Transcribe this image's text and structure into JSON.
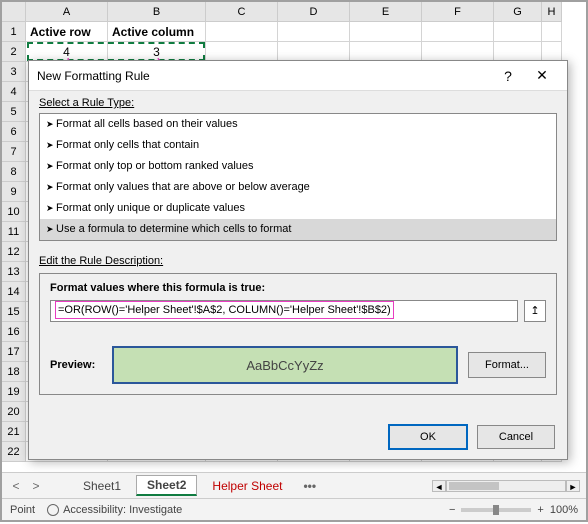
{
  "columns": [
    "A",
    "B",
    "C",
    "D",
    "E",
    "F",
    "G",
    "H"
  ],
  "rows": [
    "1",
    "2",
    "3",
    "4",
    "5",
    "6",
    "7",
    "8",
    "9",
    "10",
    "11",
    "12",
    "13",
    "14",
    "15",
    "16",
    "17",
    "18",
    "19",
    "20",
    "21",
    "22"
  ],
  "cells": {
    "A1": "Active row",
    "B1": "Active column",
    "A2": "4",
    "B2": "3"
  },
  "dialog": {
    "title": "New Formatting Rule",
    "select_label": "Select a Rule Type:",
    "rules": [
      "Format all cells based on their values",
      "Format only cells that contain",
      "Format only top or bottom ranked values",
      "Format only values that are above or below average",
      "Format only unique or duplicate values",
      "Use a formula to determine which cells to format"
    ],
    "edit_label": "Edit the Rule Description:",
    "formula_label": "Format values where this formula is true:",
    "formula": "=OR(ROW()='Helper Sheet'!$A$2, COLUMN()='Helper Sheet'!$B$2)",
    "preview_label": "Preview:",
    "preview_text": "AaBbCcYyZz",
    "format_btn": "Format...",
    "ok": "OK",
    "cancel": "Cancel"
  },
  "tabs": {
    "sheet1": "Sheet1",
    "sheet2": "Sheet2",
    "helper": "Helper Sheet",
    "more": "•••"
  },
  "status": {
    "mode": "Point",
    "accessibility": "Accessibility: Investigate",
    "zoom": "100%"
  }
}
